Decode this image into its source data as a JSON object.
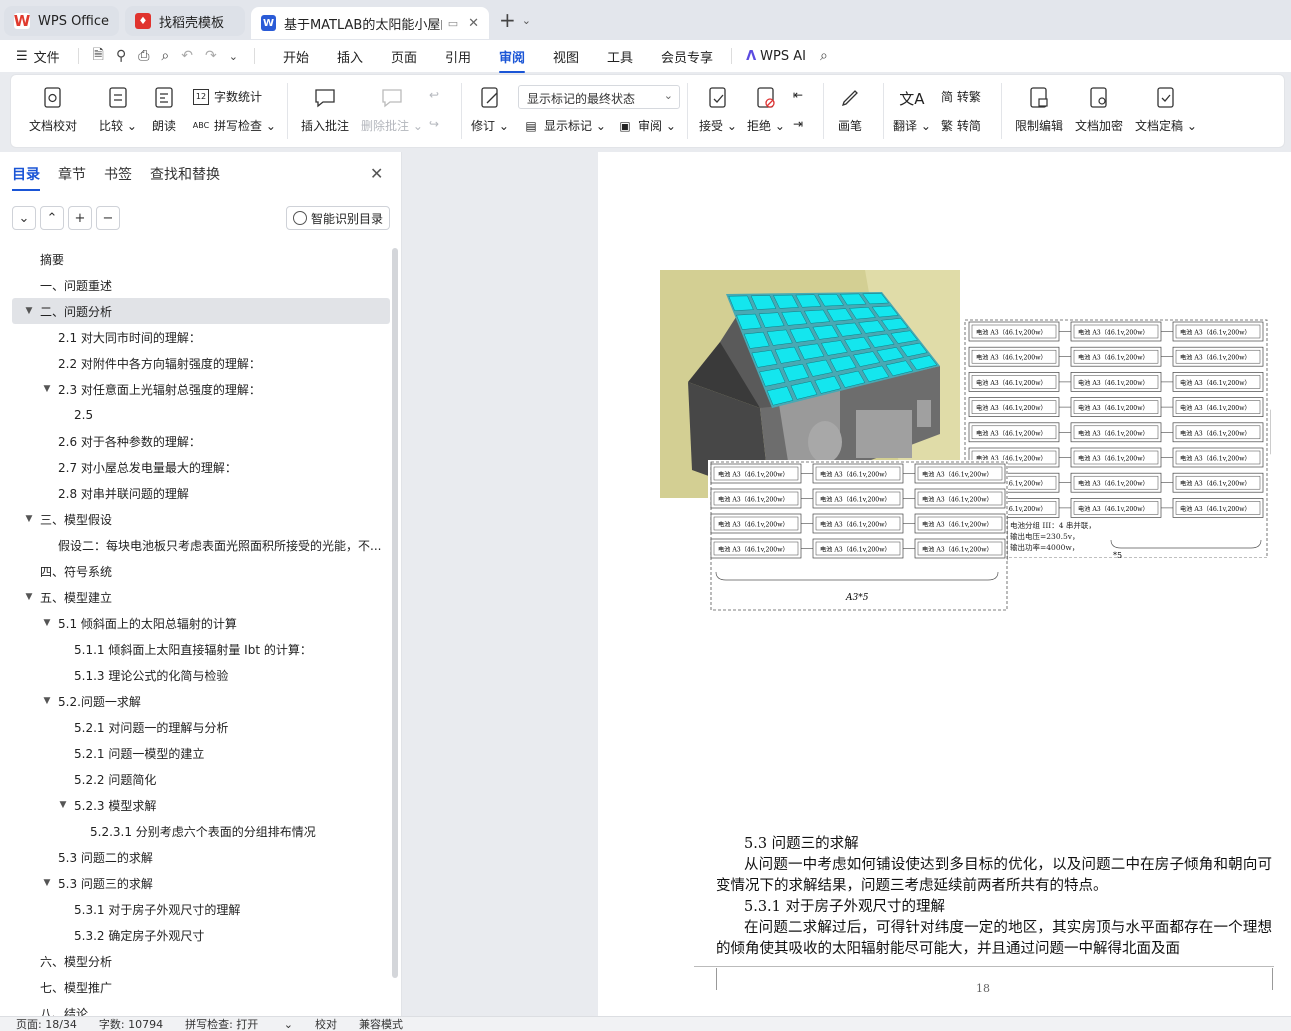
{
  "tabs": [
    {
      "label": "WPS Office",
      "color": "#e03a2e"
    },
    {
      "label": "找稻壳模板",
      "color": "#e0332e"
    },
    {
      "label": "基于MATLAB的太阳能小屋的",
      "color": "#2a5bd7",
      "active": true
    }
  ],
  "menu": {
    "file": "文件",
    "tabs": [
      "开始",
      "插入",
      "页面",
      "引用",
      "审阅",
      "视图",
      "工具",
      "会员专享"
    ],
    "active_tab": "审阅",
    "ai": "WPS AI"
  },
  "ribbon": {
    "doc_check": "文档校对",
    "compare": "比较",
    "read_aloud": "朗读",
    "word_count": "字数统计",
    "spell_check": "拼写检查",
    "insert_comment": "插入批注",
    "delete_comment": "删除批注",
    "revise": "修订",
    "markup_state": "显示标记的最终状态",
    "show_markup": "显示标记",
    "review": "审阅",
    "accept": "接受",
    "reject": "拒绝",
    "pen": "画笔",
    "translate": "翻译",
    "to_trad": "简 转繁",
    "to_simp": "繁 转简",
    "restrict_edit": "限制编辑",
    "encrypt": "文档加密",
    "finalize": "文档定稿"
  },
  "nav": {
    "tabs": [
      "目录",
      "章节",
      "书签",
      "查找和替换"
    ],
    "active_tab": "目录",
    "smart_toc": "智能识别目录",
    "items": [
      {
        "label": "摘要",
        "level": 1
      },
      {
        "label": "一、问题重述",
        "level": 1
      },
      {
        "label": "二、问题分析",
        "level": 1,
        "expanded": true,
        "selected": true
      },
      {
        "label": "2.1 对大同市时间的理解：",
        "level": 2
      },
      {
        "label": "2.2 对附件中各方向辐射强度的理解：",
        "level": 2
      },
      {
        "label": "2.3 对任意面上光辐射总强度的理解：",
        "level": 2,
        "expanded": true
      },
      {
        "label": "2.5",
        "level": 3
      },
      {
        "label": "2.6 对于各种参数的理解：",
        "level": 2
      },
      {
        "label": "2.7 对小屋总发电量最大的理解：",
        "level": 2
      },
      {
        "label": "2.8 对串并联问题的理解",
        "level": 2
      },
      {
        "label": "三、模型假设",
        "level": 1,
        "expanded": true
      },
      {
        "label": "假设二：每块电池板只考虑表面光照面积所接受的光能，不...",
        "level": 2
      },
      {
        "label": "四、符号系统",
        "level": 1
      },
      {
        "label": "五、模型建立",
        "level": 1,
        "expanded": true
      },
      {
        "label": "5.1 倾斜面上的太阳总辐射的计算",
        "level": 2,
        "expanded": true
      },
      {
        "label": "5.1.1 倾斜面上太阳直接辐射量 Ibt 的计算：",
        "level": 3
      },
      {
        "label": "5.1.3 理论公式的化简与检验",
        "level": 3
      },
      {
        "label": "5.2.问题一求解",
        "level": 2,
        "expanded": true
      },
      {
        "label": "5.2.1 对问题一的理解与分析",
        "level": 3
      },
      {
        "label": "5.2.1 问题一模型的建立",
        "level": 3
      },
      {
        "label": "5.2.2 问题简化",
        "level": 3
      },
      {
        "label": "5.2.3 模型求解",
        "level": 3,
        "expanded": true
      },
      {
        "label": "5.2.3.1 分别考虑六个表面的分组排布情况",
        "level": 4
      },
      {
        "label": "5.3 问题二的求解",
        "level": 2
      },
      {
        "label": "5.3 问题三的求解",
        "level": 2,
        "expanded": true
      },
      {
        "label": "5.3.1 对于房子外观尺寸的理解",
        "level": 3
      },
      {
        "label": "5.3.2 确定房子外观尺寸",
        "level": 3
      },
      {
        "label": "六、模型分析",
        "level": 1
      },
      {
        "label": "七、模型推广",
        "level": 1
      },
      {
        "label": "八、结论",
        "level": 1
      }
    ]
  },
  "doc": {
    "cell_label": "电池 A3（46.1v,200w）",
    "group_note1": "电池分组 III：4 串并联，",
    "group_note2": "输出电压=230.5v，",
    "group_note3": "输出功率=4000w，",
    "brace_label": "A3*5",
    "brace_label2": "*5",
    "side_note1": "电",
    "side_note2": "输",
    "side_note3": "输",
    "heading1": "5.3 问题三的求解",
    "para1": "从问题一中考虑如何铺设使达到多目标的优化，以及问题二中在房子倾角和朝向可变情况下的求解结果，问题三考虑延续前两者所共有的特点。",
    "heading2": "5.3.1 对于房子外观尺寸的理解",
    "para2": "在问题二求解过后，可得针对纬度一定的地区，其实房顶与水平面都存在一个理想的倾角使其吸收的太阳辐射能尽可能大，并且通过问题一中解得北面及面",
    "page_number": "18"
  },
  "status": {
    "page": "页面: 18/34",
    "words": "字数: 10794",
    "spell": "拼写检查: 打开",
    "proof": "校对",
    "compat": "兼容模式"
  }
}
